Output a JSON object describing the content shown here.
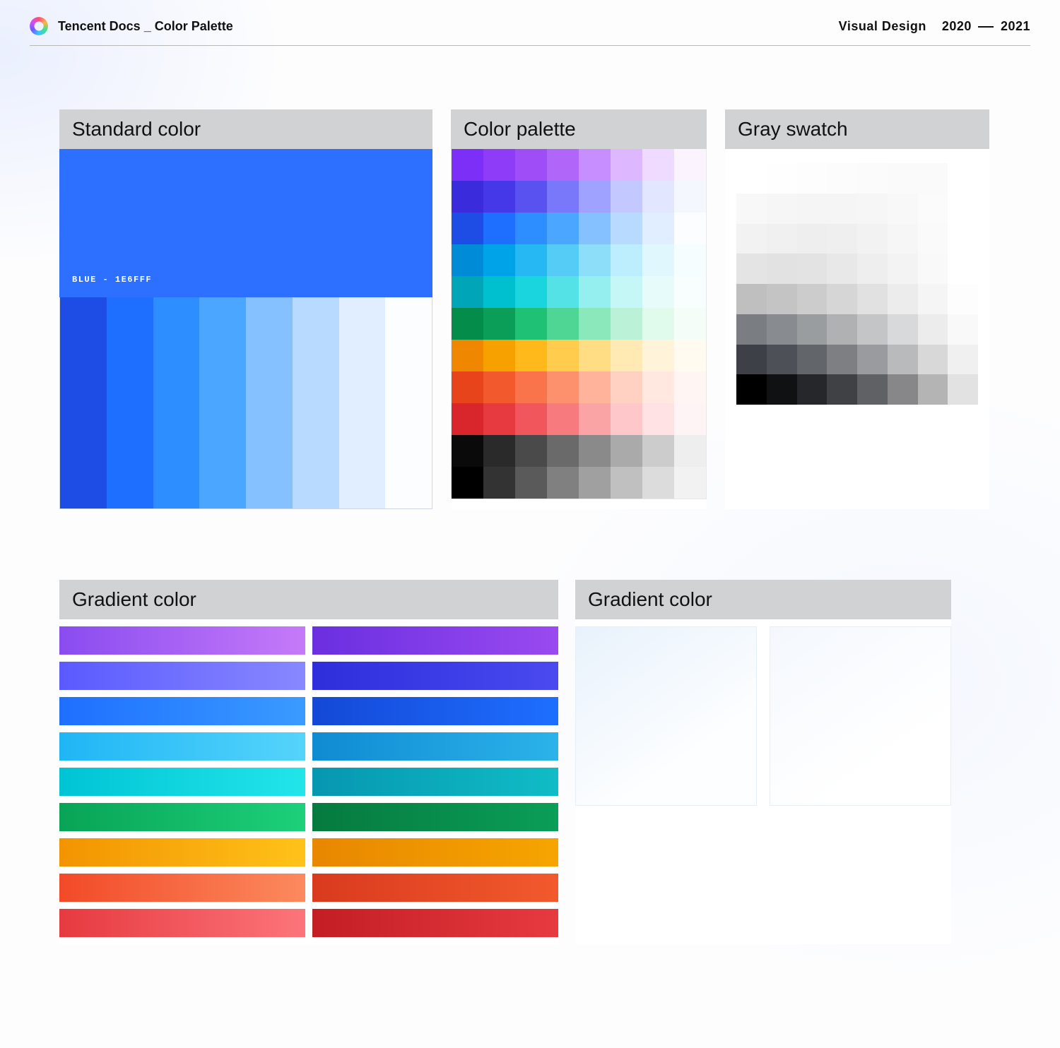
{
  "header": {
    "title": "Tencent Docs _ Color Palette",
    "right_label": "Visual Design",
    "year_from": "2020",
    "year_to": "2021"
  },
  "sections": {
    "standard": {
      "title": "Standard color",
      "hero_color": "#2d6fff",
      "hero_label": "BLUE  -  1E6FFF",
      "shades": [
        "#1e4de6",
        "#1e6fff",
        "#2d8fff",
        "#4aa6ff",
        "#85c1ff",
        "#b8daff",
        "#e1eeff",
        "#fbfdff"
      ]
    },
    "palette": {
      "title": "Color palette",
      "rows": [
        [
          "#7b2ff7",
          "#8e3cf7",
          "#9f4df7",
          "#b066f9",
          "#c78eff",
          "#ddb7ff",
          "#efdbff",
          "#fbf4ff"
        ],
        [
          "#3a2bdc",
          "#4438e8",
          "#5a52f0",
          "#7a78fa",
          "#9fa3ff",
          "#c3c8ff",
          "#e2e6ff",
          "#f5f7ff"
        ],
        [
          "#1e4de6",
          "#1e6fff",
          "#2d8fff",
          "#4aa6ff",
          "#85c1ff",
          "#b8daff",
          "#e1eeff",
          "#fbfdff"
        ],
        [
          "#008bd6",
          "#00a3e8",
          "#25b8f2",
          "#55ccf6",
          "#8ddff9",
          "#bceefd",
          "#e0f7fe",
          "#f6fdff"
        ],
        [
          "#00a6b8",
          "#00bfcf",
          "#1ad5dd",
          "#55e2e6",
          "#96efef",
          "#c6f7f7",
          "#e7fbfb",
          "#f8fefe"
        ],
        [
          "#048c4a",
          "#0a9e58",
          "#1fc274",
          "#4fd694",
          "#8be8bb",
          "#bbf2d7",
          "#e0faec",
          "#f4fdf8"
        ],
        [
          "#f08700",
          "#f7a100",
          "#ffb91a",
          "#ffcc4d",
          "#ffdd85",
          "#ffeab3",
          "#fff4d9",
          "#fffbf0"
        ],
        [
          "#e8441c",
          "#f25a2d",
          "#f9744a",
          "#fd916e",
          "#ffb39b",
          "#ffd1c2",
          "#ffe8e0",
          "#fff6f3"
        ],
        [
          "#d9262d",
          "#e63a40",
          "#f0565b",
          "#f77a7e",
          "#fba4a6",
          "#fec7c9",
          "#ffe3e4",
          "#fff4f5"
        ],
        [
          "#0a0a0a",
          "#2a2a2a",
          "#4a4a4a",
          "#6a6a6a",
          "#8a8a8a",
          "#aaaaaa",
          "#cccccc",
          "#eeeeee"
        ],
        [
          "#000000",
          "#333333",
          "#5a5a5a",
          "#808080",
          "#a0a0a0",
          "#c0c0c0",
          "#dcdcdc",
          "#f2f2f2"
        ]
      ]
    },
    "gray": {
      "title": "Gray swatch",
      "rows": [
        [
          "#ffffff",
          "#fefefe",
          "#fdfdfd",
          "#fcfcfc",
          "#fbfbfb",
          "#fafafa",
          "#fafafa",
          "#ffffff"
        ],
        [
          "#f8f8f8",
          "#f6f6f6",
          "#f5f5f5",
          "#f5f5f5",
          "#f6f6f6",
          "#f8f8f8",
          "#fbfbfb",
          "#ffffff"
        ],
        [
          "#f2f2f2",
          "#f0f0f0",
          "#eeeeee",
          "#efefef",
          "#f2f2f2",
          "#f6f6f6",
          "#fafafa",
          "#ffffff"
        ],
        [
          "#e4e4e4",
          "#e2e2e2",
          "#e3e3e3",
          "#e8e8e8",
          "#eeeeee",
          "#f3f3f3",
          "#f9f9f9",
          "#ffffff"
        ],
        [
          "#bfbfbf",
          "#c4c4c4",
          "#cccccc",
          "#d6d6d6",
          "#e1e1e1",
          "#ececec",
          "#f5f5f5",
          "#fdfdfd"
        ],
        [
          "#7a7e82",
          "#888c90",
          "#9a9da0",
          "#afb1b3",
          "#c4c5c7",
          "#d8d9da",
          "#ececed",
          "#f9f9fa"
        ],
        [
          "#3d4046",
          "#4d5056",
          "#626569",
          "#7d7f82",
          "#9a9b9e",
          "#b9babb",
          "#d8d8d9",
          "#f0f0f1"
        ],
        [
          "#000000",
          "#101113",
          "#26272a",
          "#404145",
          "#606165",
          "#878789",
          "#b4b4b5",
          "#e2e2e3"
        ]
      ]
    },
    "gradients_left": {
      "title": "Gradient color",
      "rows": [
        {
          "light": [
            "#8a4cf0",
            "#c57af8"
          ],
          "dark": [
            "#6a2fe0",
            "#9a4af0"
          ]
        },
        {
          "light": [
            "#5a5aff",
            "#8888ff"
          ],
          "dark": [
            "#2e2edc",
            "#4a4af0"
          ]
        },
        {
          "light": [
            "#1e6fff",
            "#3a9bff"
          ],
          "dark": [
            "#1448d6",
            "#1e6fff"
          ]
        },
        {
          "light": [
            "#1fb6f5",
            "#55d4fb"
          ],
          "dark": [
            "#0f8bd2",
            "#2cb3ea"
          ]
        },
        {
          "light": [
            "#00c4d4",
            "#22e5ea"
          ],
          "dark": [
            "#0697b0",
            "#10bcc6"
          ]
        },
        {
          "light": [
            "#08a455",
            "#1dd07a"
          ],
          "dark": [
            "#067a3e",
            "#0a9e58"
          ]
        },
        {
          "light": [
            "#f29400",
            "#ffc21a"
          ],
          "dark": [
            "#e88700",
            "#f6a500"
          ]
        },
        {
          "light": [
            "#f24a28",
            "#fc8a5e"
          ],
          "dark": [
            "#d93a1e",
            "#f25a2d"
          ]
        },
        {
          "light": [
            "#e63a40",
            "#fc757a"
          ],
          "dark": [
            "#c31e24",
            "#e63a40"
          ]
        }
      ]
    },
    "gradients_right": {
      "title": "Gradient color",
      "boxes": [
        {
          "from": "#e8f2fc",
          "to": "#fdfeff"
        },
        {
          "from": "#f4f8fe",
          "to": "#ffffff"
        }
      ]
    }
  }
}
